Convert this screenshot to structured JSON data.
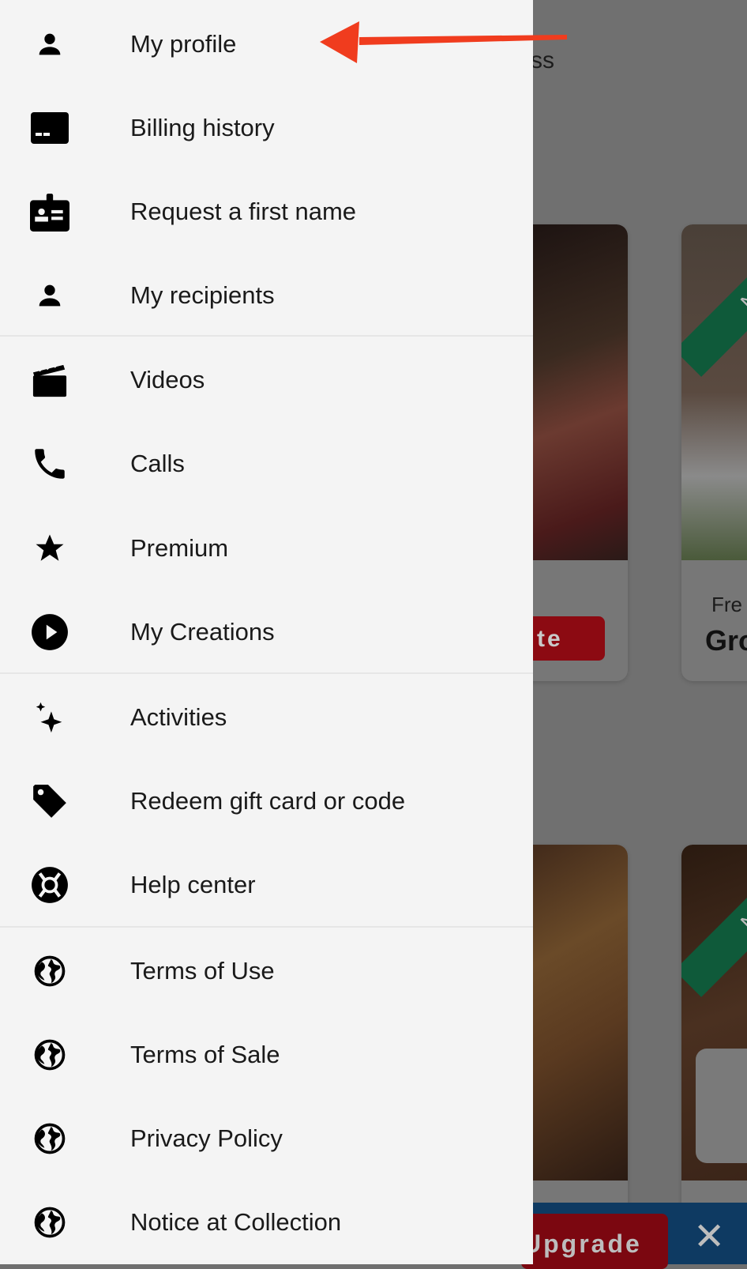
{
  "drawer": {
    "items": [
      {
        "label": "My profile",
        "icon": "person-icon"
      },
      {
        "label": "Billing history",
        "icon": "billing-icon"
      },
      {
        "label": "Request a first name",
        "icon": "badge-icon"
      },
      {
        "label": "My recipients",
        "icon": "person-icon"
      },
      {
        "label": "Videos",
        "icon": "clapperboard-icon"
      },
      {
        "label": "Calls",
        "icon": "phone-icon"
      },
      {
        "label": "Premium",
        "icon": "star-icon"
      },
      {
        "label": "My Creations",
        "icon": "play-circle-icon"
      },
      {
        "label": "Activities",
        "icon": "sparkles-icon"
      },
      {
        "label": "Redeem gift card or code",
        "icon": "tag-icon"
      },
      {
        "label": "Help center",
        "icon": "lifebuoy-icon"
      },
      {
        "label": "Terms of Use",
        "icon": "globe-icon"
      },
      {
        "label": "Terms of Sale",
        "icon": "globe-icon"
      },
      {
        "label": "Privacy Policy",
        "icon": "globe-icon"
      },
      {
        "label": "Notice at Collection",
        "icon": "globe-icon"
      }
    ]
  },
  "background": {
    "partial_heading": "ss",
    "card1_button": "te",
    "card2_ribbon": "New",
    "card2_subtitle": "Fre",
    "card2_title": "Gro",
    "card4_ribbon": "New",
    "banner_upgrade": "Upgrade",
    "banner_close": "✕"
  },
  "annotation": {
    "color": "#f03c1e",
    "type": "arrow pointing to My profile"
  },
  "colors": {
    "drawer_bg": "#f4f4f4",
    "overlay": "#707070"
  }
}
